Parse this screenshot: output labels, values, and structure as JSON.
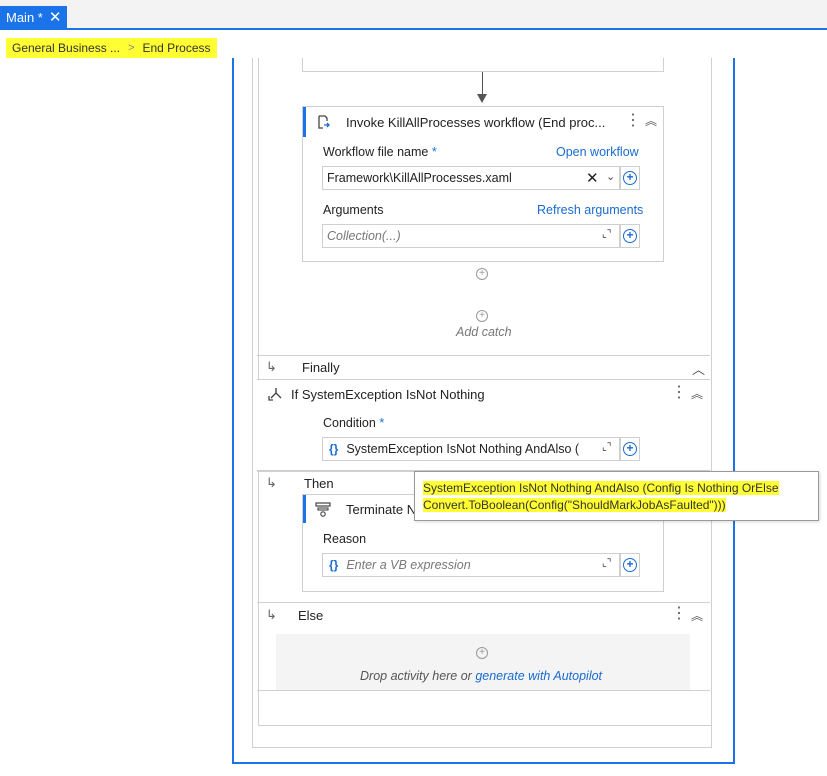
{
  "tab": {
    "label": "Main *",
    "close": "✕"
  },
  "breadcrumb": {
    "items": [
      "General Business ...",
      "End Process"
    ]
  },
  "invoke": {
    "title": "Invoke KillAllProcesses workflow (End proc...",
    "workflow_label": "Workflow file name",
    "required_mark": "*",
    "open_link": "Open workflow",
    "workflow_value": "Framework\\KillAllProcesses.xaml",
    "arguments_label": "Arguments",
    "refresh_link": "Refresh arguments",
    "arguments_placeholder": "Collection(...)"
  },
  "add_catch": "Add catch",
  "finally": {
    "label": "Finally"
  },
  "if_activity": {
    "title": "If SystemException IsNot Nothing",
    "condition_label": "Condition",
    "required_mark": "*",
    "condition_value": "SystemException IsNot Nothing AndAlso ("
  },
  "then": {
    "label": "Then"
  },
  "terminate": {
    "title": "Terminate N",
    "reason_label": "Reason",
    "reason_placeholder": "Enter a VB expression"
  },
  "else": {
    "label": "Else"
  },
  "drop": {
    "text": "Drop activity here or ",
    "link": "generate with Autopilot"
  },
  "tooltip": {
    "line1": "SystemException IsNot Nothing AndAlso (Config Is Nothing OrElse",
    "line2": "Convert.ToBoolean(Config(\"ShouldMarkJobAsFaulted\")))"
  },
  "colors": {
    "accent": "#1a73e8",
    "highlight": "#ffff33",
    "link": "#1a6bd0"
  }
}
